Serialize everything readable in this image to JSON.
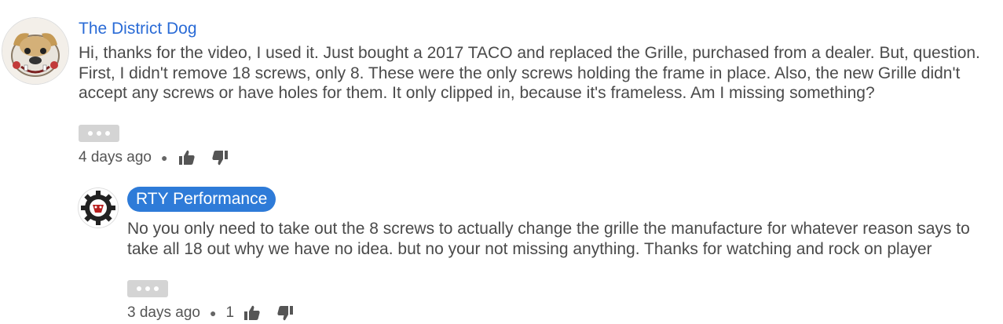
{
  "comments": [
    {
      "author": "The District Dog",
      "text": "Hi, thanks for the video, I used it. Just bought a 2017 TACO and replaced the Grille, purchased from a dealer. But, question. First, I didn't remove 18 screws, only 8. These were the only screws holding the frame in place. Also, the new Grille didn't accept any screws or have holes for them. It only clipped in, because it's frameless. Am I missing something?",
      "time": "4 days ago",
      "likes": "",
      "avatar_icon": "bulldog-avatar"
    },
    {
      "author": "RTY Performance",
      "text": "No you only need to take out the 8 screws to actually change the grille the manufacture for whatever reason says to take all 18 out why we have no idea. but no your not missing anything. Thanks for watching and rock on player",
      "time": "3 days ago",
      "likes": "1",
      "avatar_icon": "gear-logo-avatar"
    }
  ],
  "colors": {
    "link_blue": "#2a6bd6",
    "highlight_badge": "#2e7bd8",
    "body_text": "#4a4a4a"
  }
}
